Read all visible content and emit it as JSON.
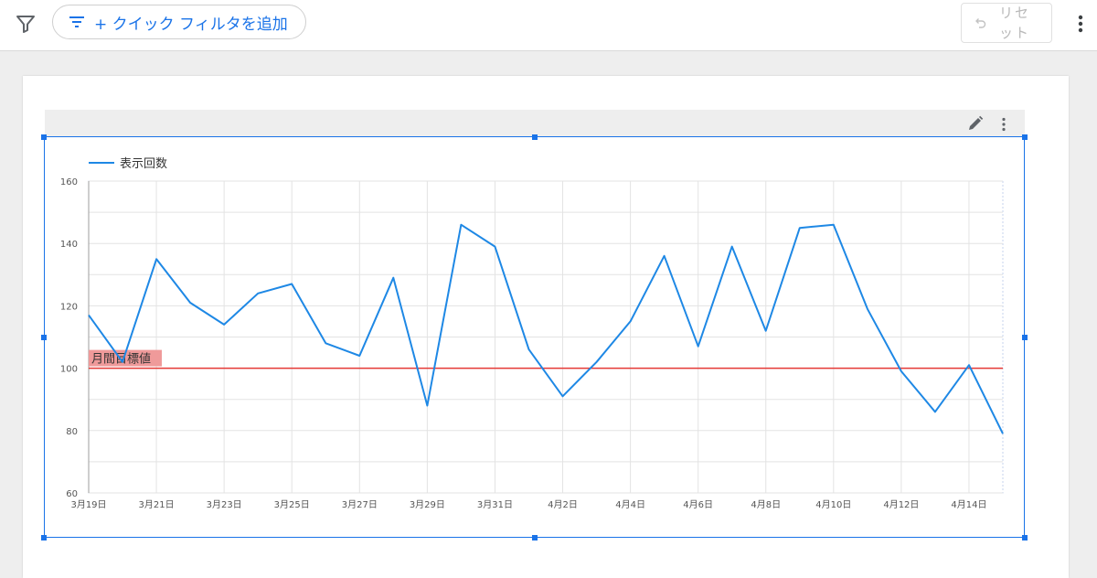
{
  "toolbar": {
    "quick_filter_label": "+ クイック フィルタを追加",
    "reset_label": "リセット"
  },
  "icons": {
    "filter": "filter-funnel-icon",
    "quick_filter": "filter-list-icon",
    "undo": "undo-icon",
    "more": "more-vert-icon",
    "edit": "pencil-icon"
  },
  "colors": {
    "accent": "#1a73e8",
    "series": "#1e88e5",
    "target": "#e53935",
    "target_label_bg": "#ef9a9a"
  },
  "chart_data": {
    "type": "line",
    "legend": "top-left",
    "grid": true,
    "x": [
      "3月19日",
      "3月20日",
      "3月21日",
      "3月22日",
      "3月23日",
      "3月24日",
      "3月25日",
      "3月26日",
      "3月27日",
      "3月28日",
      "3月29日",
      "3月30日",
      "3月31日",
      "4月1日",
      "4月2日",
      "4月3日",
      "4月4日",
      "4月5日",
      "4月6日",
      "4月7日",
      "4月8日",
      "4月9日",
      "4月10日",
      "4月11日",
      "4月12日",
      "4月13日",
      "4月14日",
      "4月15日"
    ],
    "x_tick_labels": [
      "3月19日",
      "3月21日",
      "3月23日",
      "3月25日",
      "3月27日",
      "3月29日",
      "3月31日",
      "4月2日",
      "4月4日",
      "4月6日",
      "4月8日",
      "4月10日",
      "4月12日",
      "4月14日"
    ],
    "series": [
      {
        "name": "表示回数",
        "values": [
          117,
          102,
          135,
          121,
          114,
          124,
          127,
          108,
          104,
          129,
          88,
          146,
          139,
          106,
          91,
          102,
          115,
          136,
          107,
          139,
          112,
          145,
          146,
          119,
          99,
          86,
          101,
          79
        ]
      }
    ],
    "reference_line": {
      "label": "月間目標値",
      "value": 100
    },
    "ylim": [
      60,
      160
    ],
    "y_ticks": [
      60,
      80,
      100,
      120,
      140,
      160
    ]
  }
}
